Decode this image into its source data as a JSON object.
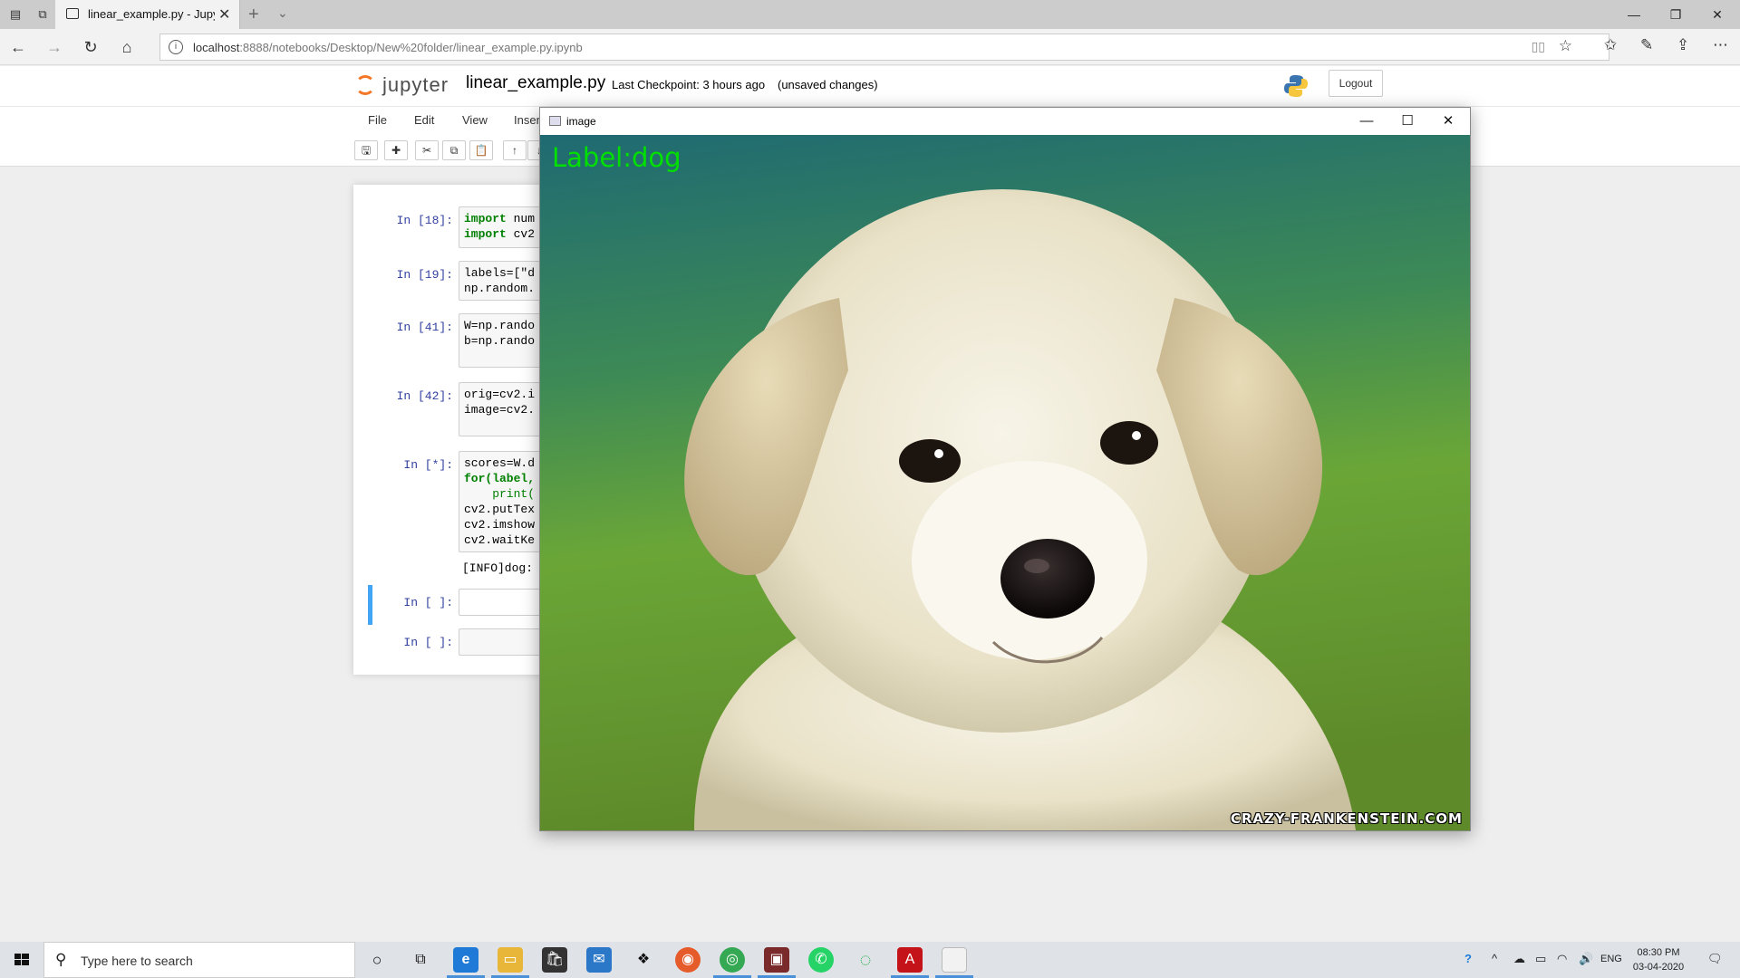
{
  "browser": {
    "tab_title": "linear_example.py - Jupyter",
    "url_host": "localhost",
    "url_rest": ":8888/notebooks/Desktop/New%20folder/linear_example.py.ipynb"
  },
  "jupyter": {
    "logo_text": "jupyter",
    "notebook_name": "linear_example.py",
    "checkpoint": "Last Checkpoint: 3 hours ago",
    "status": "(unsaved changes)",
    "logout_label": "Logout",
    "menu": [
      "File",
      "Edit",
      "View",
      "Insert"
    ],
    "toolbar_icons": [
      "save-icon",
      "plus-icon",
      "cut-icon",
      "copy-icon",
      "paste-icon",
      "arrow-up-icon",
      "arrow-down-icon"
    ]
  },
  "cells": [
    {
      "prompt": "In [18]:",
      "lines": [
        "import num",
        "import cv2"
      ]
    },
    {
      "prompt": "In [19]:",
      "lines": [
        "labels=[\"d",
        "np.random."
      ]
    },
    {
      "prompt": "In [41]:",
      "lines": [
        "W=np.rando",
        "b=np.rando"
      ]
    },
    {
      "prompt": "In [42]:",
      "lines": [
        "orig=cv2.i",
        "image=cv2."
      ]
    },
    {
      "prompt": "In [*]:",
      "lines": [
        "scores=W.d",
        "for(label,",
        "    print(",
        "cv2.putTex",
        "cv2.imshow",
        "cv2.waitKe"
      ],
      "output": "[INFO]dog:"
    },
    {
      "prompt": "In [ ]:",
      "lines": [
        ""
      ]
    },
    {
      "prompt": "In [ ]:",
      "lines": [
        ""
      ]
    }
  ],
  "image_window": {
    "title": "image",
    "label_overlay": "Label:dog",
    "watermark": "CRAZY-FRANKENSTEIN.COM",
    "subject": "white puppy on green background"
  },
  "taskbar": {
    "search_placeholder": "Type here to search",
    "language": "ENG",
    "time": "08:30 PM",
    "date": "03-04-2020"
  },
  "colors": {
    "jupyter_orange": "#f37726",
    "prompt_blue": "#303f9f",
    "label_green": "#00e000",
    "selected_cell_bar": "#42a5f5"
  }
}
